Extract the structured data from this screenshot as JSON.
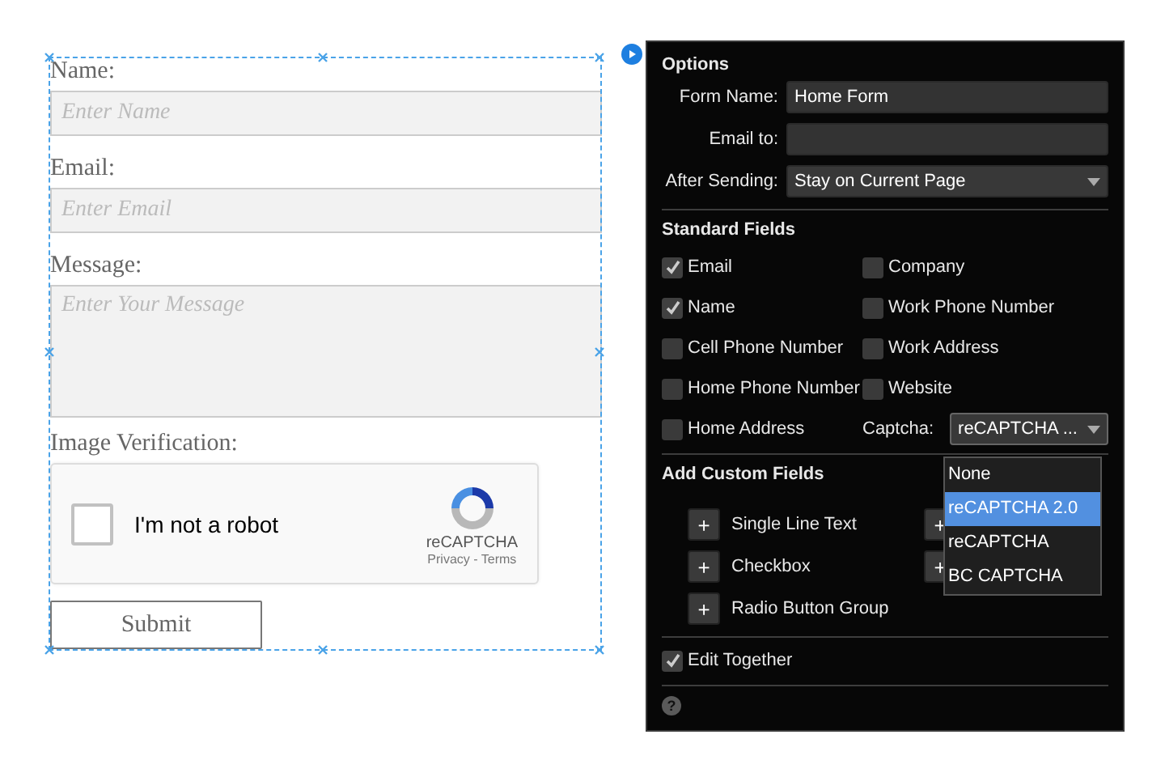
{
  "form": {
    "fields": [
      {
        "kind": "input",
        "label": "Name:",
        "placeholder": "Enter Name"
      },
      {
        "kind": "input",
        "label": "Email:",
        "placeholder": "Enter Email"
      },
      {
        "kind": "textarea",
        "label": "Message:",
        "placeholder": "Enter Your Message"
      }
    ],
    "captcha": {
      "label": "Image Verification:",
      "checkbox_label": "I'm not a robot",
      "checked": false,
      "brand": "reCAPTCHA",
      "links": "Privacy - Terms"
    },
    "submit": "Submit"
  },
  "panel": {
    "options_title": "Options",
    "options": [
      {
        "kind": "text",
        "label": "Form Name:",
        "value": "Home Form"
      },
      {
        "kind": "text",
        "label": "Email to:"
      },
      {
        "kind": "select",
        "label": "After Sending:",
        "value": "Stay on Current Page"
      }
    ],
    "standard_title": "Standard Fields",
    "standard_fields": [
      {
        "label": "Email",
        "checked": true
      },
      {
        "label": "Company",
        "checked": false
      },
      {
        "label": "Name",
        "checked": true
      },
      {
        "label": "Work Phone Number",
        "checked": false
      },
      {
        "label": "Cell Phone Number",
        "checked": false
      },
      {
        "label": "Work Address",
        "checked": false
      },
      {
        "label": "Home Phone Number",
        "checked": false
      },
      {
        "label": "Website",
        "checked": false
      },
      {
        "label": "Home Address",
        "checked": false
      }
    ],
    "captcha": {
      "label": "Captcha:",
      "value": "reCAPTCHA ...",
      "expanded": true,
      "options": [
        {
          "label": "None",
          "selected": false
        },
        {
          "label": "reCAPTCHA 2.0",
          "selected": true
        },
        {
          "label": "reCAPTCHA",
          "selected": false
        },
        {
          "label": "BC CAPTCHA",
          "selected": false
        }
      ]
    },
    "custom_title": "Add Custom Fields",
    "custom_fields": [
      {
        "button": "+",
        "label": "Single Line Text"
      },
      {
        "button": "+"
      },
      {
        "button": "+",
        "label": "Checkbox"
      },
      {
        "button": "+"
      },
      {
        "button": "+",
        "label": "Radio Button Group"
      }
    ],
    "edit_together": {
      "label": "Edit Together",
      "checked": true
    },
    "help": "?"
  }
}
